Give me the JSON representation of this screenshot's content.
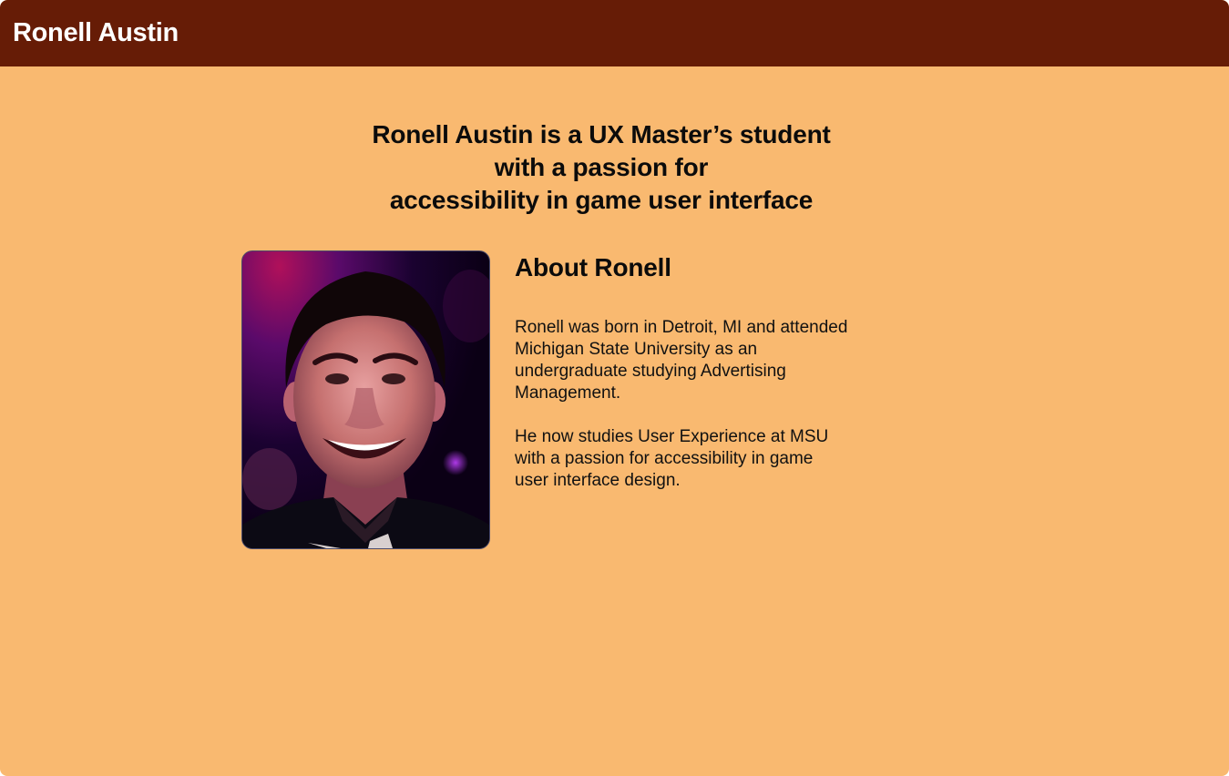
{
  "header": {
    "title": "Ronell Austin"
  },
  "headline": {
    "lines": [
      "Ronell Austin is a UX Master’s student",
      "with a passion for",
      "accessibility in game user interface"
    ]
  },
  "about": {
    "title": "About Ronell",
    "paragraph1_lines": [
      "Ronell was born in Detroit, MI and attended",
      "Michigan State University as an",
      "undergraduate studying Advertising",
      "Management."
    ],
    "paragraph2_lines": [
      "He now studies User Experience at MSU",
      "with a passion for accessibility in game",
      "user interface design."
    ]
  },
  "colors": {
    "background": "#f9b970",
    "header": "#661c06",
    "header_text": "#ffffff",
    "text": "#0b0b0b"
  }
}
